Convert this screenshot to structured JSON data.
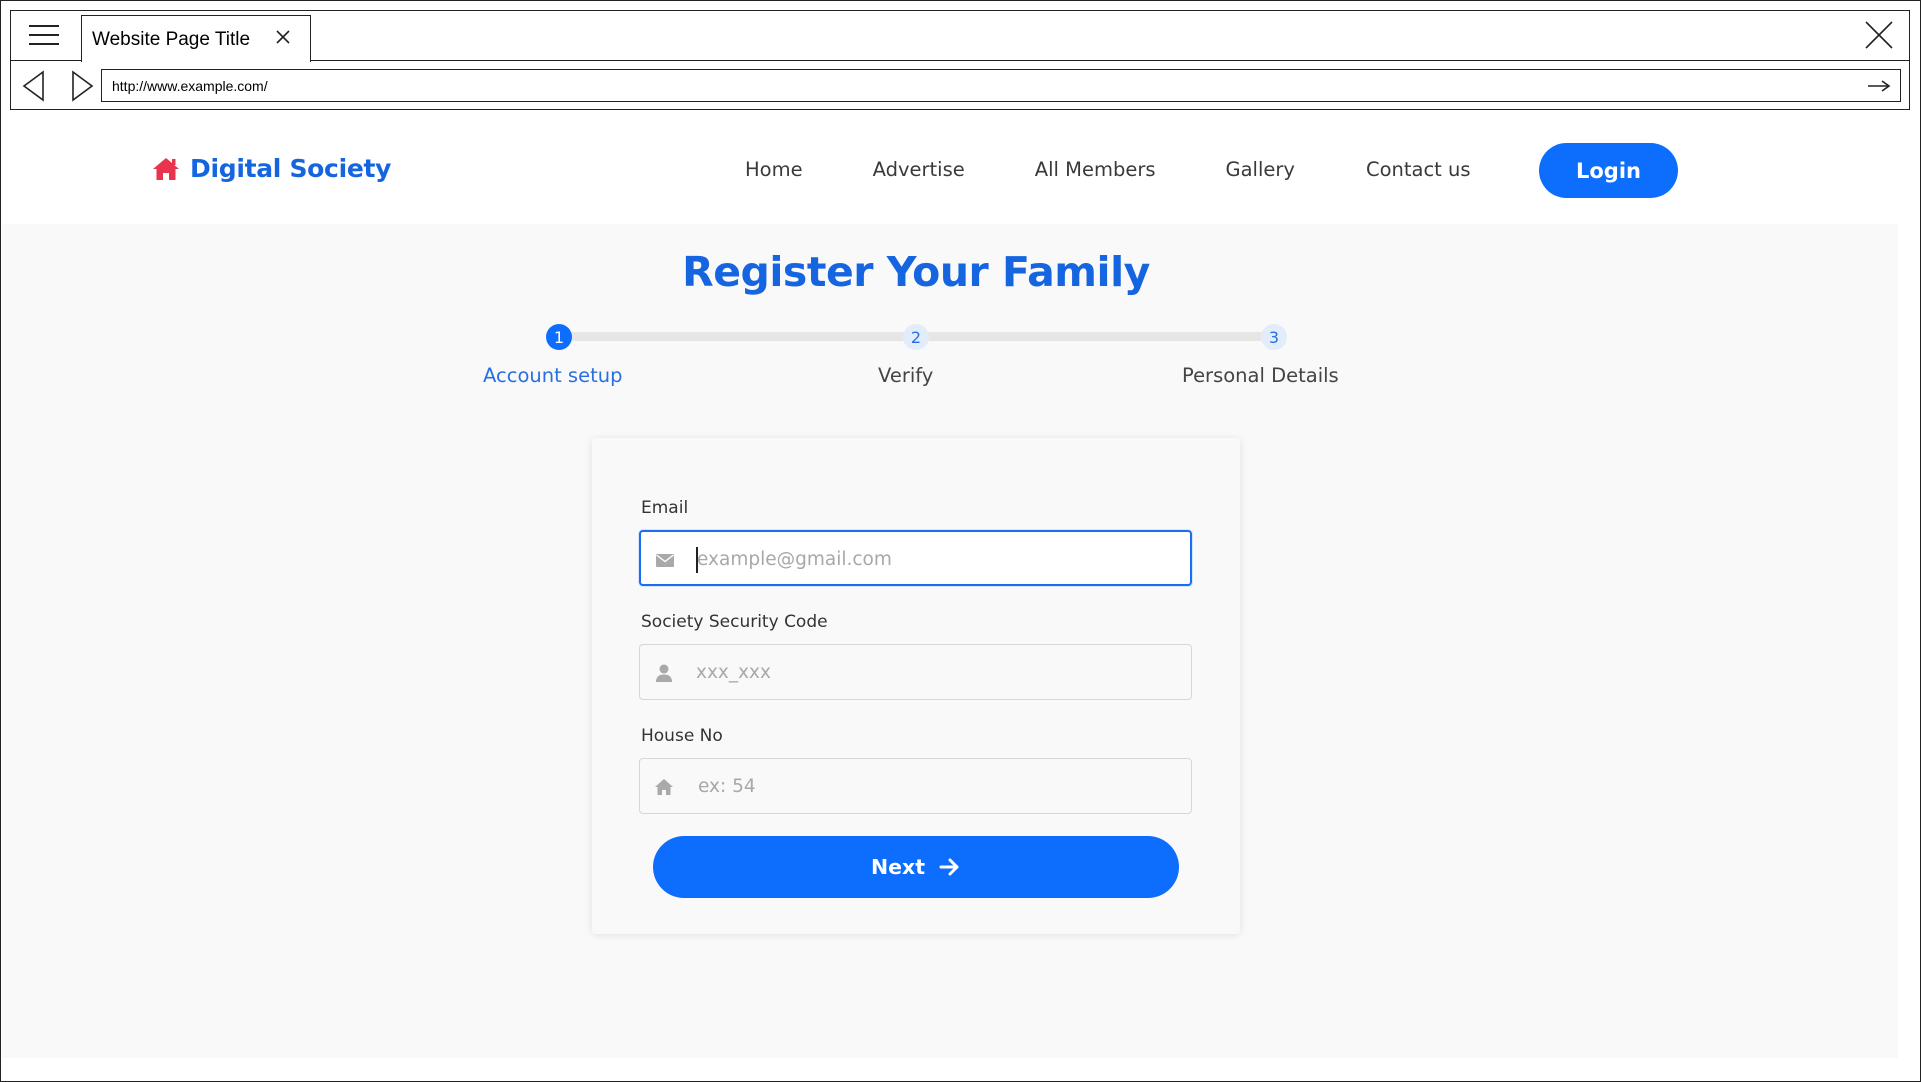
{
  "browser": {
    "tab_title": "Website Page Title",
    "url": "http://www.example.com/",
    "icons": {
      "menu": "hamburger-icon",
      "tab_close": "close-icon",
      "window_close": "close-icon",
      "back": "back-arrow-icon",
      "forward": "forward-arrow-icon",
      "go": "go-arrow-icon"
    }
  },
  "header": {
    "logo_text": "Digital Society",
    "logo_icon": "home-icon",
    "logo_color": "#e8344e",
    "nav": {
      "home": "Home",
      "advertise": "Advertise",
      "members": "All Members",
      "gallery": "Gallery",
      "contact": "Contact us"
    },
    "login_label": "Login"
  },
  "main": {
    "title": "Register Your Family",
    "steps": [
      {
        "number": "1",
        "label": "Account setup",
        "state": "active"
      },
      {
        "number": "2",
        "label": "Verify",
        "state": "upcoming"
      },
      {
        "number": "3",
        "label": "Personal Details",
        "state": "upcoming"
      }
    ],
    "form": {
      "email": {
        "label": "Email",
        "placeholder": "example@gmail.com",
        "value": "",
        "icon": "envelope-icon"
      },
      "security_code": {
        "label": "Society Security Code",
        "placeholder": "xxx_xxx",
        "value": "",
        "icon": "user-icon"
      },
      "house_no": {
        "label": "House No",
        "placeholder": "ex: 54",
        "value": "",
        "icon": "home-icon"
      },
      "next_label": "Next",
      "next_icon": "arrow-right-icon"
    }
  },
  "colors": {
    "primary": "#0d6efd",
    "title_blue": "#1565e0",
    "content_bg": "#f9f9f9"
  }
}
